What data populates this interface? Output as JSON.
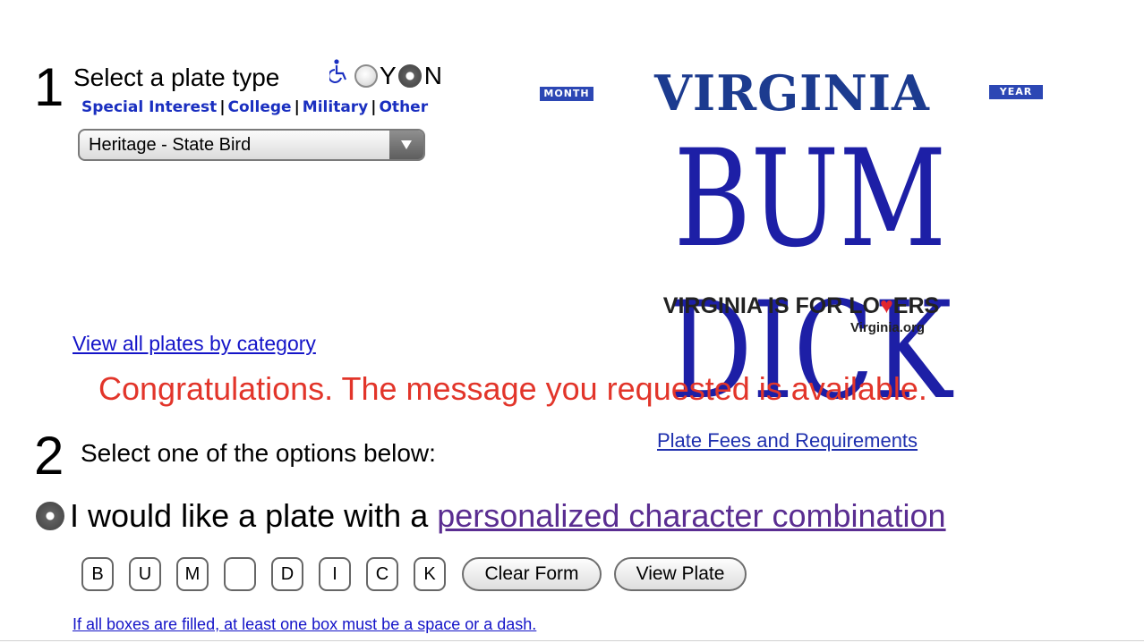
{
  "step1": {
    "number": "1",
    "label": "Select a plate type",
    "accessible": {
      "icon": "wheelchair-icon",
      "yes_label": "Y",
      "no_label": "N",
      "selected": "N"
    },
    "categories": [
      "Special Interest",
      "College",
      "Military",
      "Other"
    ],
    "plate_select": {
      "value": "Heritage - State Bird"
    },
    "view_all_link": "View all plates by category"
  },
  "plate_preview": {
    "state": "VIRGINIA",
    "month_label": "MONTH",
    "year_label": "YEAR",
    "message": "BUM DICK",
    "slogan_pre": "VIRGINIA IS FOR LO",
    "slogan_post": "ERS",
    "website": "Virginia.org",
    "colors": {
      "state": "#1c3b8f",
      "message": "#1d1fa6",
      "heart": "#e3262e"
    }
  },
  "congrats": "Congratulations. The message you requested is available.",
  "step2": {
    "number": "2",
    "label": "Select one of the options below:",
    "fees_link": "Plate Fees and Requirements"
  },
  "option": {
    "prefix": "I would like a plate with a ",
    "link": "personalized character combination",
    "selected": true
  },
  "char_boxes": [
    "B",
    "U",
    "M",
    "",
    "D",
    "I",
    "C",
    "K"
  ],
  "buttons": {
    "clear": "Clear Form",
    "view": "View Plate"
  },
  "rule_link": "If all boxes are filled, at least one box must be a space or a dash."
}
